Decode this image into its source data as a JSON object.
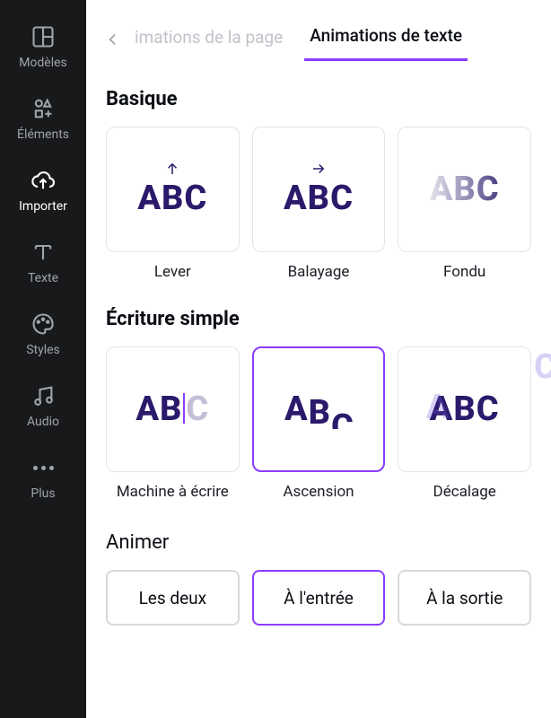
{
  "sidebar": {
    "items": [
      {
        "label": "Modèles"
      },
      {
        "label": "Éléments"
      },
      {
        "label": "Importer"
      },
      {
        "label": "Texte"
      },
      {
        "label": "Styles"
      },
      {
        "label": "Audio"
      },
      {
        "label": "Plus"
      }
    ]
  },
  "tabs": {
    "inactive": "imations de la page",
    "active": "Animations de texte"
  },
  "sections": {
    "basique": {
      "title": "Basique",
      "items": [
        {
          "label": "Lever"
        },
        {
          "label": "Balayage"
        },
        {
          "label": "Fondu"
        }
      ]
    },
    "ecriture": {
      "title": "Écriture simple",
      "items": [
        {
          "label": "Machine à écrire"
        },
        {
          "label": "Ascension"
        },
        {
          "label": "Décalage"
        }
      ]
    }
  },
  "animer": {
    "title": "Animer",
    "options": [
      {
        "label": "Les deux"
      },
      {
        "label": "À l'entrée"
      },
      {
        "label": "À la sortie"
      }
    ]
  },
  "preview_text": "ABC",
  "colors": {
    "accent": "#8b3dff",
    "abc": "#2b1a6b",
    "sidebar_bg": "#18191b"
  }
}
